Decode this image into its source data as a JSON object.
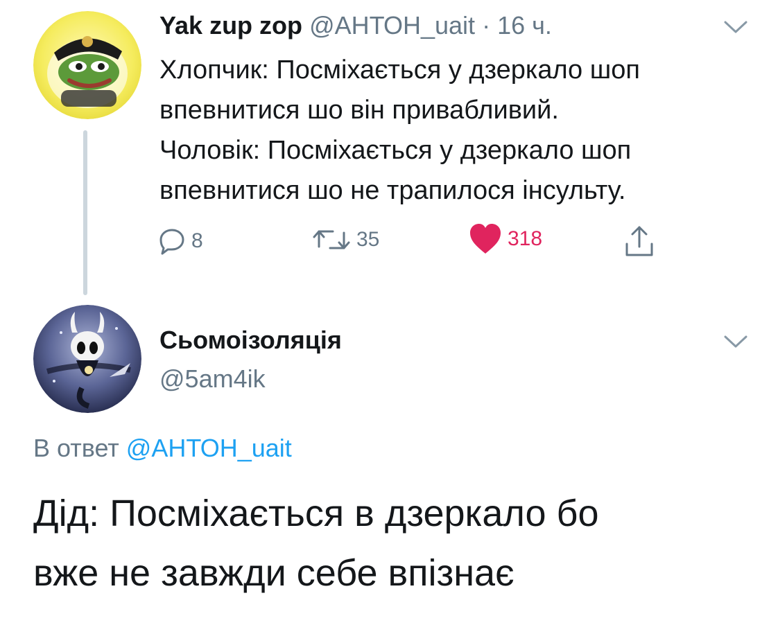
{
  "parent_tweet": {
    "display_name": "Yak zup zop",
    "handle": "@АНТОН_uait",
    "separator": "·",
    "time": "16 ч.",
    "avatar_icon": "pepe-frog-avatar",
    "text_lines": [
      "Хлопчик: Посміхається у дзеркало шоп",
      "впевнитися шо він привабливий.",
      "Чоловік: Посміхається у дзеркало шоп",
      "впевнитися шо не трапилося інсульту."
    ],
    "actions": {
      "reply_count": "8",
      "retweet_count": "35",
      "like_count": "318",
      "liked": true
    }
  },
  "reply_tweet": {
    "display_name": "Сьомоізоляція",
    "handle": "@5am4ik",
    "avatar_icon": "hollow-knight-avatar",
    "in_reply_prefix": "В ответ",
    "in_reply_mention": "@АНТОН_uait",
    "text_lines": [
      "Дід: Посміхається в дзеркало бо",
      "вже не завжди себе впізнає"
    ]
  },
  "colors": {
    "text": "#14171a",
    "muted": "#657786",
    "link": "#1da1f2",
    "like": "#e0245e",
    "thread_line": "#ccd6dd"
  }
}
